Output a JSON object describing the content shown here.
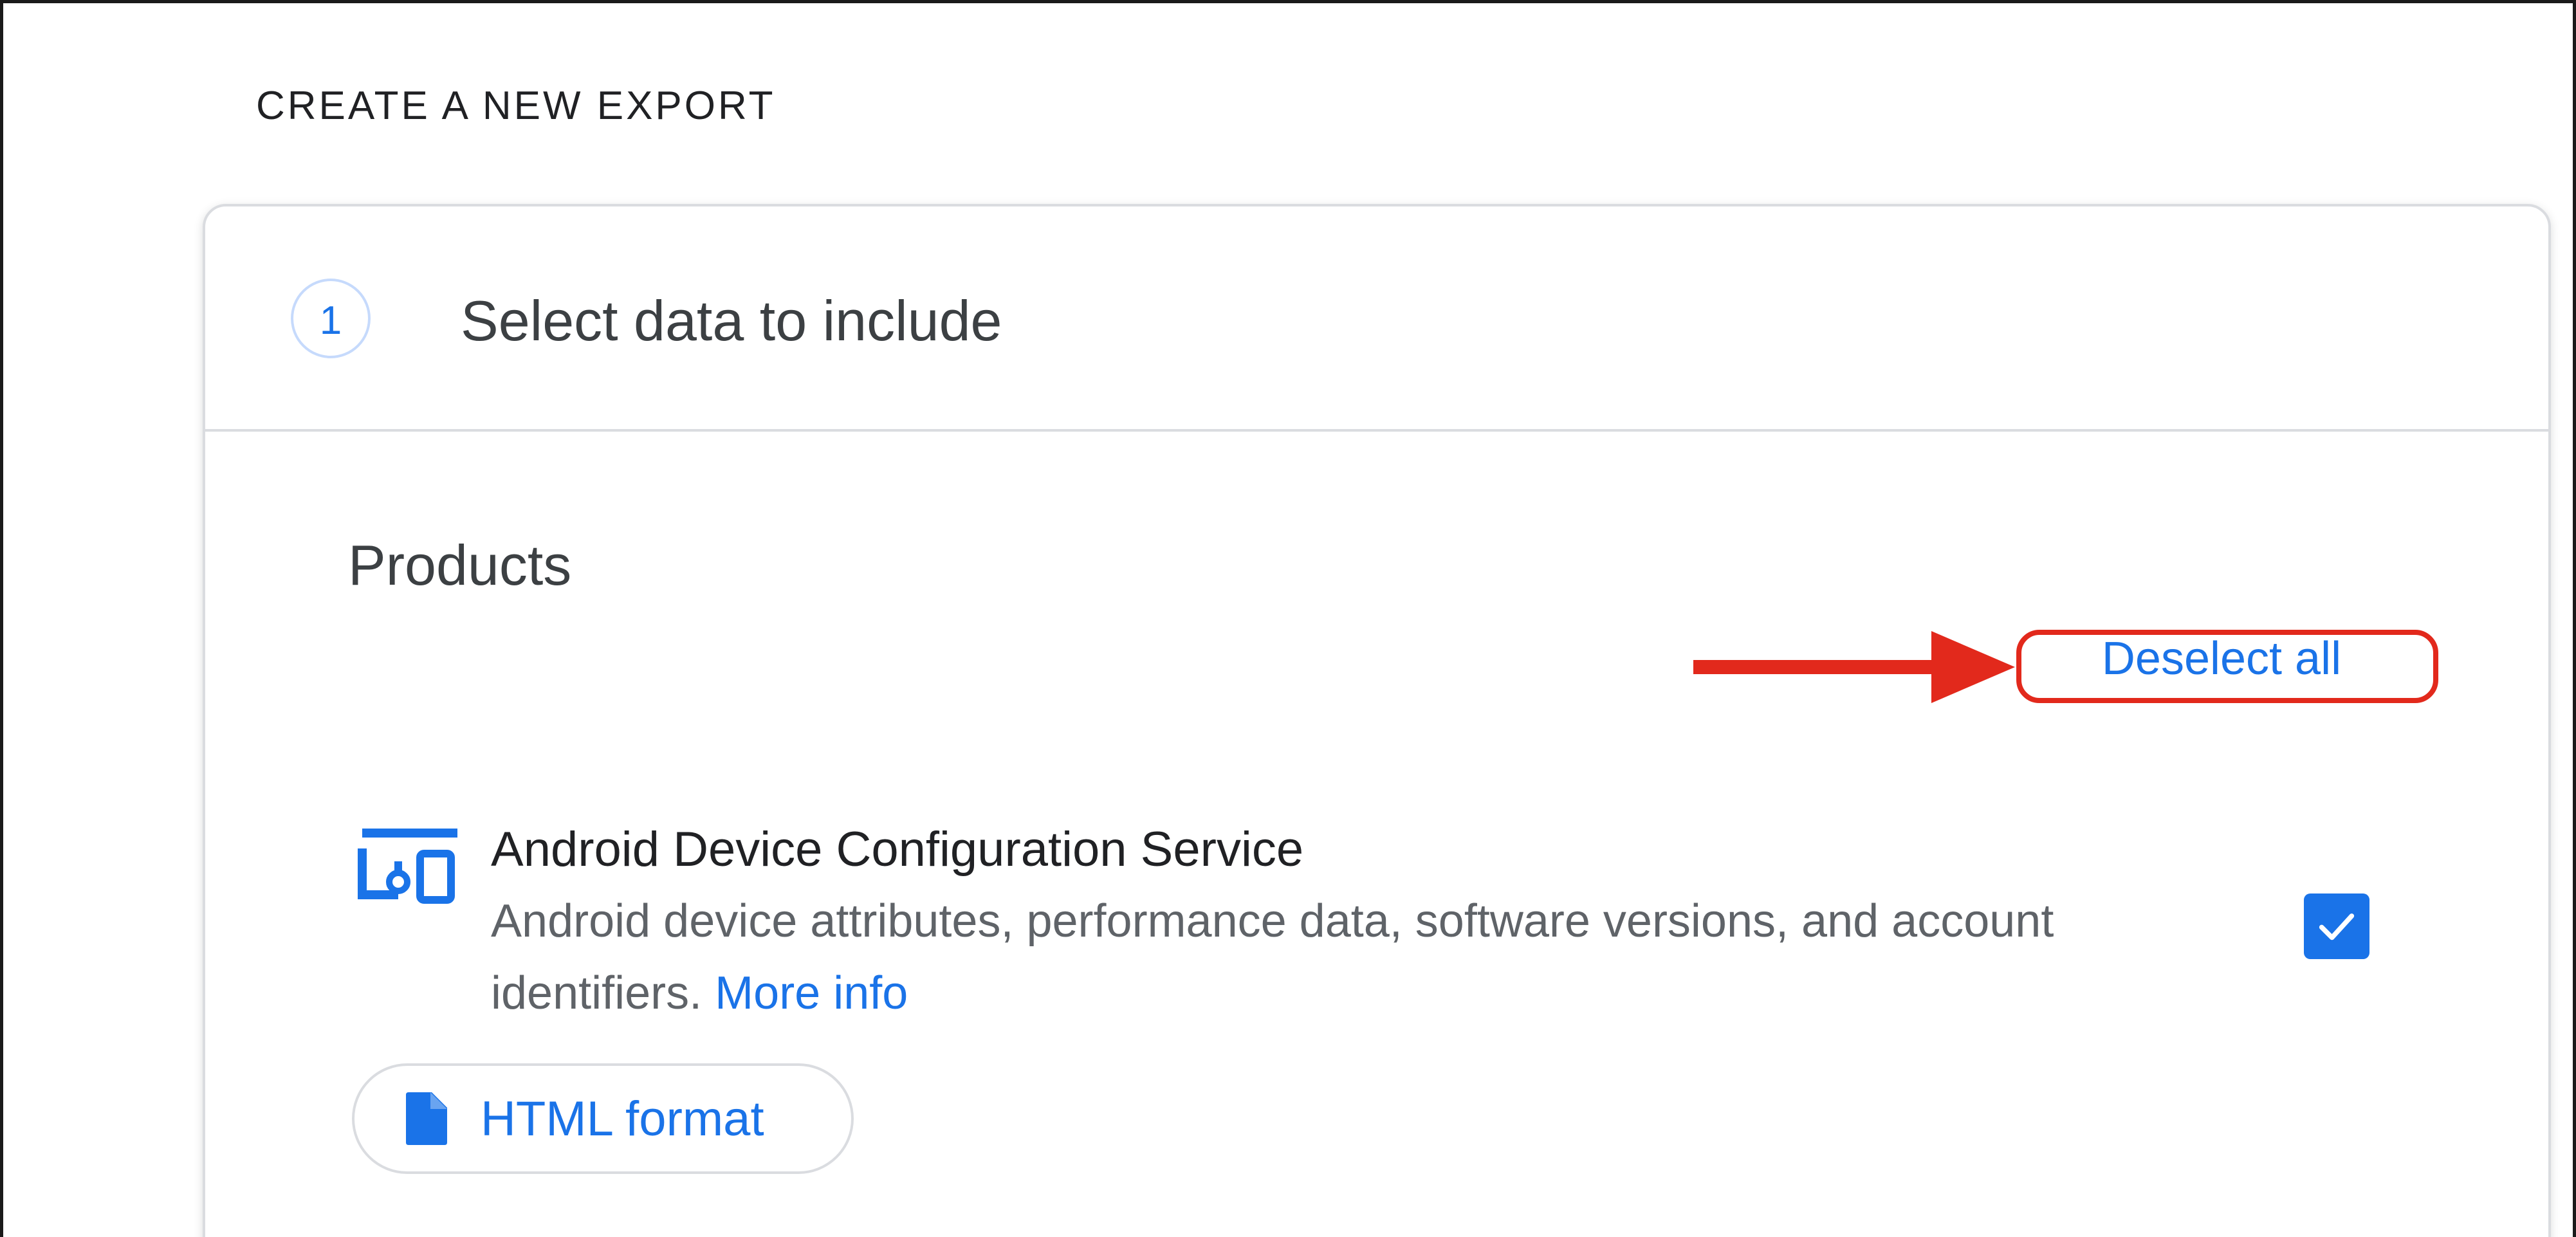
{
  "page": {
    "heading": "CREATE A NEW EXPORT"
  },
  "step": {
    "number": "1",
    "title": "Select data to include"
  },
  "products": {
    "heading": "Products",
    "deselect_all_label": "Deselect all",
    "items": [
      {
        "name": "Android Device Configuration Service",
        "description": "Android device attributes, performance data, software versions, and account identifiers.",
        "more_info_label": "More info",
        "icon": "devices-icon",
        "checked": true,
        "format_label": "HTML format",
        "format_icon": "file-icon"
      }
    ]
  },
  "annotation": {
    "highlight_color": "#e2291c",
    "arrow_color": "#e2291c"
  },
  "colors": {
    "accent": "#1a73e8",
    "border": "#dadce0",
    "text_primary": "#202124",
    "text_secondary": "#5f6368"
  }
}
